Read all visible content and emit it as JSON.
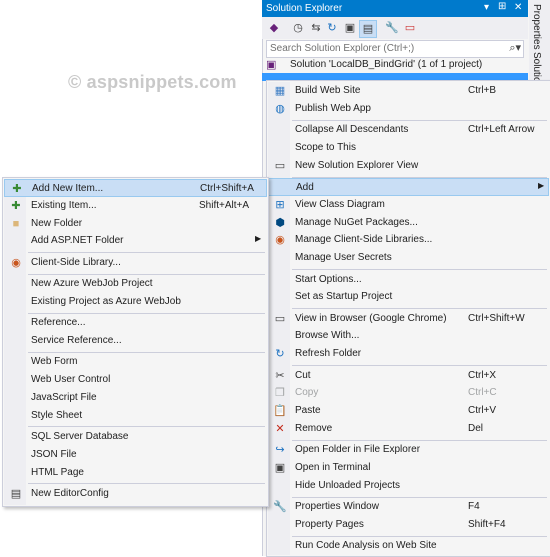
{
  "watermark": "© aspsnippets.com",
  "solution_explorer": {
    "title": "Solution Explorer",
    "title_buttons": [
      "▾",
      "⊞",
      "✕"
    ],
    "search_placeholder": "Search Solution Explorer (Ctrl+;)",
    "solution_label": "Solution 'LocalDB_BindGrid' (1 of 1 project)",
    "side_tabs": [
      "Properties",
      "Solution"
    ]
  },
  "context_menu": {
    "items": [
      {
        "label": "Build Web Site",
        "shortcut": "Ctrl+B",
        "icon": "build-icon"
      },
      {
        "label": "Publish Web App",
        "shortcut": "",
        "icon": "globe-icon"
      },
      {
        "sep": true
      },
      {
        "label": "Collapse All Descendants",
        "shortcut": "Ctrl+Left Arrow",
        "icon": ""
      },
      {
        "label": "Scope to This",
        "shortcut": "",
        "icon": ""
      },
      {
        "label": "New Solution Explorer View",
        "shortcut": "",
        "icon": "new-view-icon"
      },
      {
        "sep": true
      },
      {
        "label": "Add",
        "shortcut": "",
        "icon": "",
        "submenu": true,
        "highlighted": true
      },
      {
        "label": "View Class Diagram",
        "shortcut": "",
        "icon": "class-diagram-icon"
      },
      {
        "label": "Manage NuGet Packages...",
        "shortcut": "",
        "icon": "nuget-icon"
      },
      {
        "label": "Manage Client-Side Libraries...",
        "shortcut": "",
        "icon": "library-icon"
      },
      {
        "label": "Manage User Secrets",
        "shortcut": "",
        "icon": ""
      },
      {
        "sep": true
      },
      {
        "label": "Start Options...",
        "shortcut": "",
        "icon": ""
      },
      {
        "label": "Set as Startup Project",
        "shortcut": "",
        "icon": ""
      },
      {
        "sep": true
      },
      {
        "label": "View in Browser (Google Chrome)",
        "shortcut": "Ctrl+Shift+W",
        "icon": "browser-icon"
      },
      {
        "label": "Browse With...",
        "shortcut": "",
        "icon": ""
      },
      {
        "label": "Refresh Folder",
        "shortcut": "",
        "icon": "refresh-icon"
      },
      {
        "sep": true
      },
      {
        "label": "Cut",
        "shortcut": "Ctrl+X",
        "icon": "scissors-icon"
      },
      {
        "label": "Copy",
        "shortcut": "Ctrl+C",
        "icon": "copy-icon",
        "disabled": true
      },
      {
        "label": "Paste",
        "shortcut": "Ctrl+V",
        "icon": "paste-icon"
      },
      {
        "label": "Remove",
        "shortcut": "Del",
        "icon": "remove-icon"
      },
      {
        "sep": true
      },
      {
        "label": "Open Folder in File Explorer",
        "shortcut": "",
        "icon": "open-folder-icon"
      },
      {
        "label": "Open in Terminal",
        "shortcut": "",
        "icon": "terminal-icon"
      },
      {
        "label": "Hide Unloaded Projects",
        "shortcut": "",
        "icon": ""
      },
      {
        "sep": true
      },
      {
        "label": "Properties Window",
        "shortcut": "F4",
        "icon": "wrench-icon"
      },
      {
        "label": "Property Pages",
        "shortcut": "Shift+F4",
        "icon": ""
      },
      {
        "sep": true
      },
      {
        "label": "Run Code Analysis on Web Site",
        "shortcut": "",
        "icon": ""
      }
    ]
  },
  "add_submenu": {
    "items": [
      {
        "label": "Add New Item...",
        "shortcut": "Ctrl+Shift+A",
        "icon": "new-item-icon",
        "highlighted": true
      },
      {
        "label": "Existing Item...",
        "shortcut": "Shift+Alt+A",
        "icon": "existing-item-icon"
      },
      {
        "label": "New Folder",
        "shortcut": "",
        "icon": "folder-icon"
      },
      {
        "label": "Add ASP.NET Folder",
        "shortcut": "",
        "icon": "",
        "submenu": true
      },
      {
        "sep": true
      },
      {
        "label": "Client-Side Library...",
        "shortcut": "",
        "icon": "library-icon"
      },
      {
        "sep": true
      },
      {
        "label": "New Azure WebJob Project",
        "shortcut": "",
        "icon": ""
      },
      {
        "label": "Existing Project as Azure WebJob",
        "shortcut": "",
        "icon": ""
      },
      {
        "sep": true
      },
      {
        "label": "Reference...",
        "shortcut": "",
        "icon": ""
      },
      {
        "label": "Service Reference...",
        "shortcut": "",
        "icon": ""
      },
      {
        "sep": true
      },
      {
        "label": "Web Form",
        "shortcut": "",
        "icon": ""
      },
      {
        "label": "Web User Control",
        "shortcut": "",
        "icon": ""
      },
      {
        "label": "JavaScript File",
        "shortcut": "",
        "icon": ""
      },
      {
        "label": "Style Sheet",
        "shortcut": "",
        "icon": ""
      },
      {
        "sep": true
      },
      {
        "label": "SQL Server Database",
        "shortcut": "",
        "icon": ""
      },
      {
        "label": "JSON File",
        "shortcut": "",
        "icon": ""
      },
      {
        "label": "HTML Page",
        "shortcut": "",
        "icon": ""
      },
      {
        "sep": true
      },
      {
        "label": "New EditorConfig",
        "shortcut": "",
        "icon": "editorconfig-icon"
      }
    ]
  },
  "colors": {
    "accent": "#007acc",
    "highlight": "#c9def5",
    "menu_bg": "#f5f5f5"
  }
}
